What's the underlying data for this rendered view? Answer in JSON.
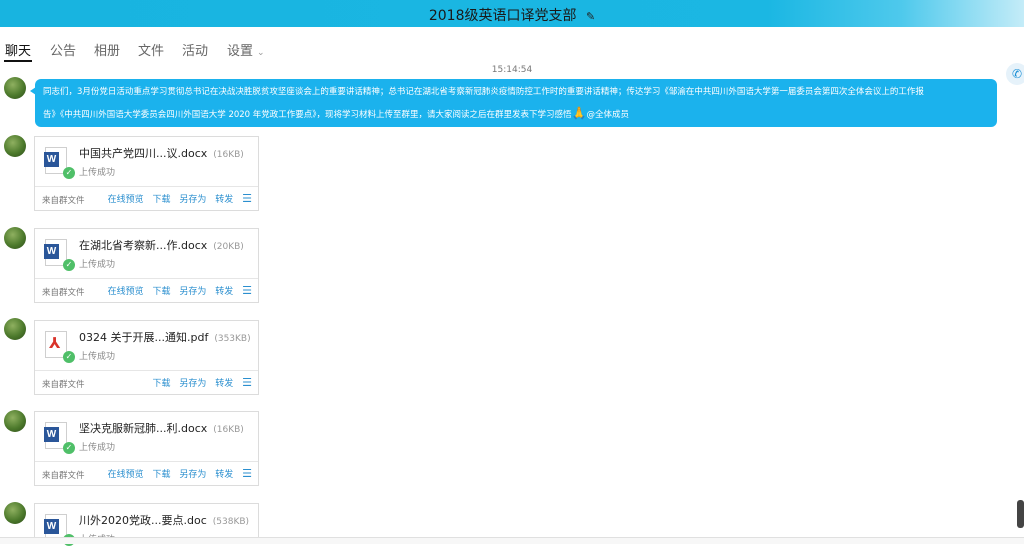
{
  "window": {
    "title": "2018级英语口译党支部",
    "edit_icon": "✎"
  },
  "tabs": [
    {
      "label": "聊天",
      "active": true
    },
    {
      "label": "公告"
    },
    {
      "label": "相册"
    },
    {
      "label": "文件"
    },
    {
      "label": "活动"
    },
    {
      "label": "设置",
      "chevron": "⌄"
    }
  ],
  "call_icon": "✆",
  "chat": {
    "time": "15:14:54",
    "message": {
      "line1": "同志们，3月份党日活动重点学习贯彻总书记在决战决胜脱贫攻坚座谈会上的重要讲话精神；总书记在湖北省考察新冠肺炎疫情防控工作时的重要讲话精神；传达学习《邹渝在中共四川外国语大学第一届委员会第四次全体会议上的工作报",
      "line2": "告》《中共四川外国语大学委员会四川外国语大学 2020 年党政工作要点》，现将学习材料上传至群里，请大家阅读之后在群里发表下学习感悟",
      "emoji": "🙏",
      "mention": "@全体成员",
      "bubble_color": "#1bb2ed"
    },
    "files": [
      {
        "name": "中国共产党四川...议.docx",
        "size": "(16KB)",
        "type": "word",
        "status": "上传成功",
        "source": "来自群文件",
        "actions": [
          "在线预览",
          "下载",
          "另存为",
          "转发"
        ]
      },
      {
        "name": "在湖北省考察新...作.docx",
        "size": "(20KB)",
        "type": "word",
        "status": "上传成功",
        "source": "来自群文件",
        "actions": [
          "在线预览",
          "下载",
          "另存为",
          "转发"
        ]
      },
      {
        "name": "0324 关于开展...通知.pdf",
        "size": "(353KB)",
        "type": "pdf",
        "status": "上传成功",
        "source": "来自群文件",
        "actions": [
          "下载",
          "另存为",
          "转发"
        ]
      },
      {
        "name": "坚决克服新冠肺...利.docx",
        "size": "(16KB)",
        "type": "word",
        "status": "上传成功",
        "source": "来自群文件",
        "actions": [
          "在线预览",
          "下载",
          "另存为",
          "转发"
        ]
      },
      {
        "name": "川外2020党政...要点.doc",
        "size": "(538KB)",
        "type": "word",
        "status": "上传成功",
        "source": "",
        "actions": []
      }
    ]
  }
}
